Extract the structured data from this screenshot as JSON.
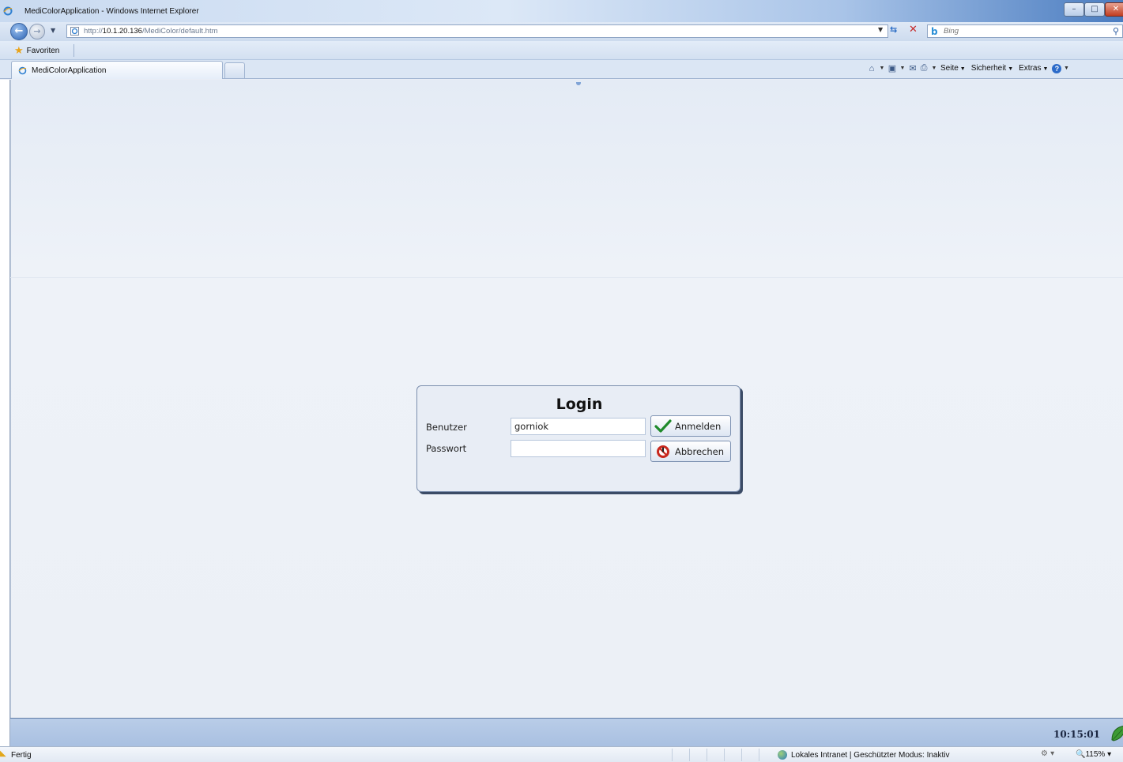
{
  "window": {
    "title": "MediColorApplication - Windows Internet Explorer",
    "min_glyph": "–",
    "max_glyph": "□",
    "close_glyph": "✕"
  },
  "address": {
    "url_prefix": "http://",
    "url_host": "10.1.20.136",
    "url_path": "/MediColor/default.htm"
  },
  "search": {
    "placeholder": "Bing",
    "engine_glyph": "b"
  },
  "favorites": {
    "label": "Favoriten"
  },
  "tabs": [
    {
      "label": "MediColorApplication",
      "active": true
    }
  ],
  "command_bar": {
    "page_label": "Seite",
    "safety_label": "Sicherheit",
    "tools_label": "Extras",
    "help_glyph": "?"
  },
  "login": {
    "title": "Login",
    "user_label": "Benutzer",
    "user_value": "gorniok",
    "password_label": "Passwort",
    "password_value": "",
    "login_button": "Anmelden",
    "cancel_button": "Abbrechen"
  },
  "app_bar": {
    "clock": "10:15:01"
  },
  "status_bar": {
    "status": "Fertig",
    "zone": "Lokales Intranet | Geschützter Modus: Inaktiv",
    "zoom": "115%"
  },
  "colors": {
    "accent": "#2b62b3",
    "ok_check": "#1f8a2b",
    "cancel_red": "#c8281e",
    "app_bar": "#b9cde8"
  }
}
